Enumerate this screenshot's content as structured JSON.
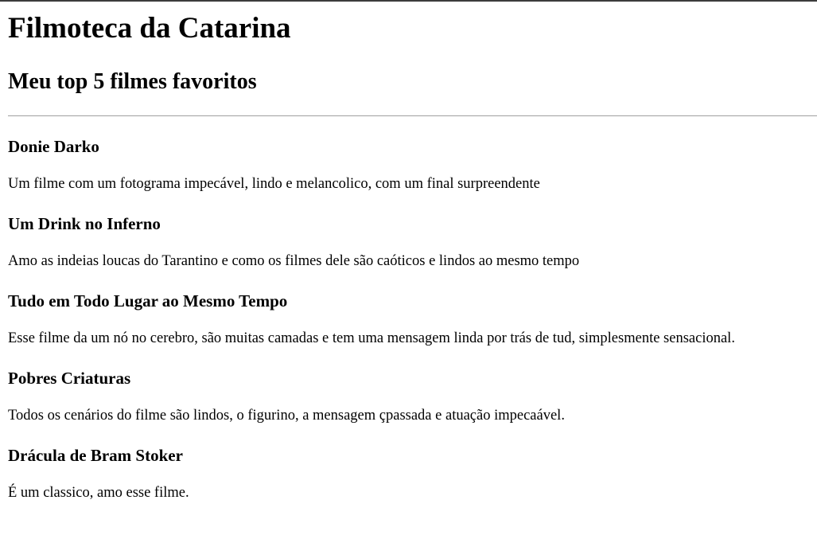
{
  "header": {
    "title": "Filmoteca da Catarina",
    "subtitle": "Meu top 5 filmes favoritos"
  },
  "films": [
    {
      "title": "Donie Darko",
      "description": "Um filme com um fotograma impecável, lindo e melancolico, com um final surpreendente"
    },
    {
      "title": "Um Drink no Inferno",
      "description": "Amo as indeias loucas do Tarantino e como os filmes dele são caóticos e lindos ao mesmo tempo"
    },
    {
      "title": "Tudo em Todo Lugar ao Mesmo Tempo",
      "description": "Esse filme da um nó no cerebro, são muitas camadas e tem uma mensagem linda por trás de tud, simplesmente sensacional."
    },
    {
      "title": "Pobres Criaturas",
      "description": "Todos os cenários do filme são lindos, o figurino, a mensagem çpassada e atuação impecaável."
    },
    {
      "title": "Drácula de Bram Stoker",
      "description": "É um classico, amo esse filme."
    }
  ]
}
